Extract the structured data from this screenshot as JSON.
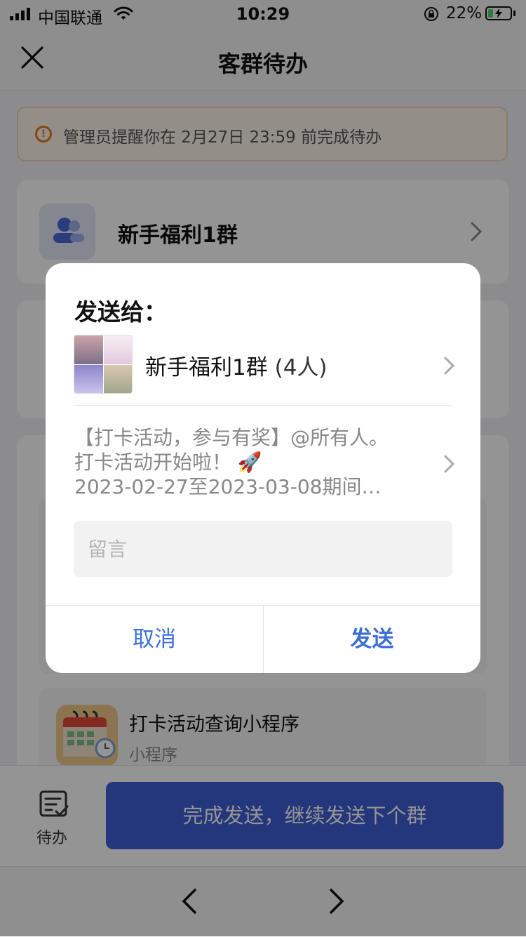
{
  "status_bar": {
    "carrier": "中国联通",
    "time": "10:29",
    "battery_percent": "22%",
    "battery_level": 0.22
  },
  "nav": {
    "title": "客群待办"
  },
  "banner": {
    "text": "管理员提醒你在 2月27日 23:59 前完成待办"
  },
  "group_card": {
    "name": "新手福利1群"
  },
  "mini_program": {
    "title": "打卡活动查询小程序",
    "subtitle": "小程序"
  },
  "bottom_bar": {
    "todo_label": "待办",
    "main_button": "完成发送，继续发送下个群"
  },
  "dialog": {
    "title": "发送给：",
    "group_name": "新手福利1群",
    "member_count": "(4人)",
    "message_lines": [
      "【打卡活动，参与有奖】@所有人。",
      "打卡活动开始啦！ 🚀",
      "2023-02-27至2023-03-08期间…"
    ],
    "input_placeholder": "留言",
    "input_value": "",
    "cancel_label": "取消",
    "send_label": "发送"
  },
  "colors": {
    "accent": "#3f5dd6",
    "dialog_button": "#3b6fd6",
    "warning": "#e07a1f"
  },
  "icons": [
    "signal-icon",
    "wifi-icon",
    "orientation-lock-icon",
    "battery-icon",
    "close-icon",
    "alert-icon",
    "group-icon",
    "chevron-right-icon",
    "calendar-icon",
    "todo-list-icon",
    "chevron-left-icon"
  ]
}
